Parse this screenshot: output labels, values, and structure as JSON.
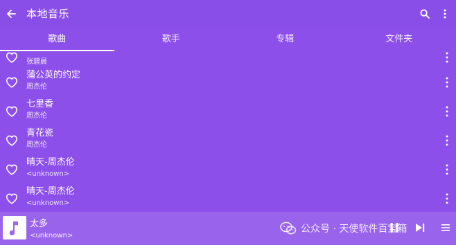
{
  "app_bar": {
    "title": "本地音乐",
    "back_icon": "arrow-left-icon",
    "search_icon": "search-icon",
    "menu_icon": "more-vertical-icon"
  },
  "tabs": [
    {
      "label": "歌曲",
      "active": true
    },
    {
      "label": "歌手",
      "active": false
    },
    {
      "label": "专辑",
      "active": false
    },
    {
      "label": "文件夹",
      "active": false
    }
  ],
  "songs": [
    {
      "title": "",
      "artist": "张碧晨"
    },
    {
      "title": "蒲公英的约定",
      "artist": "周杰伦"
    },
    {
      "title": "七里香",
      "artist": "周杰伦"
    },
    {
      "title": "青花瓷",
      "artist": "周杰伦"
    },
    {
      "title": "晴天-周杰伦",
      "artist": "<unknown>"
    },
    {
      "title": "晴天-周杰伦",
      "artist": "<unknown>"
    }
  ],
  "player": {
    "title": "太多",
    "artist": "<unknown>",
    "album_icon": "music-note-icon"
  },
  "watermark": {
    "text": "公众号 · 天使软件百宝箱",
    "icon": "wechat-icon"
  },
  "colors": {
    "primary": "#8d4fea",
    "player_bar": "#9a63ec",
    "text": "#ffffff"
  }
}
